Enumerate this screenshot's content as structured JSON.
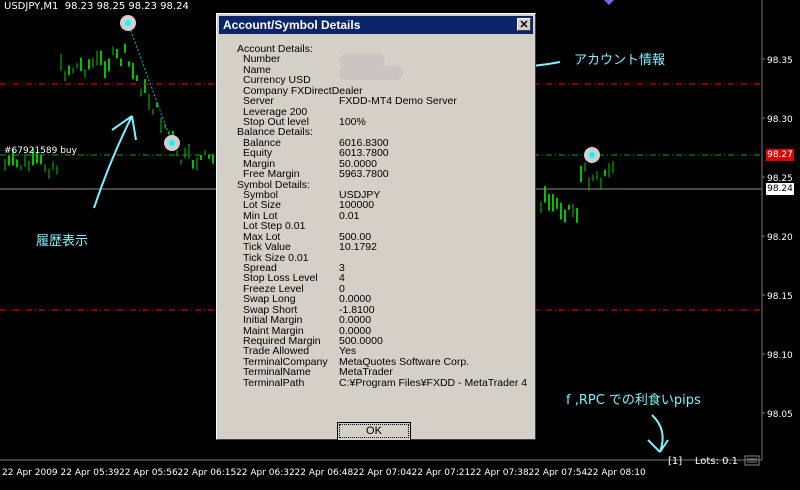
{
  "chart": {
    "symbol": "USDJPY,M1",
    "ohlc": "98.23 98.25 98.23 98.24",
    "ticket": "#67921589 buy",
    "prices": [
      "98.35",
      "98.30",
      "98.25",
      "98.20",
      "98.15",
      "98.10",
      "98.05"
    ],
    "price_red": "98.27",
    "price_white": "98.24",
    "times": [
      "22 Apr 2009",
      "22 Apr 05:39",
      "22 Apr 05:56",
      "22 Apr 06:15",
      "22 Apr 06:32",
      "22 Apr 06:48",
      "22 Apr 07:04",
      "22 Apr 07:21",
      "22 Apr 07:38",
      "22 Apr 07:54",
      "22 Apr 08:10"
    ],
    "status_index": "[1]",
    "lots": "Lots: 0.1",
    "colors": {
      "bull": "#00c000",
      "bear": "#006400",
      "redline": "#ff0000",
      "greenline": "#00aa00"
    }
  },
  "annotations": {
    "account": "アカウント情報",
    "history": "履歴表示",
    "pips": "f ,RPC での利食いpips"
  },
  "dialog": {
    "title": "Account/Symbol Details",
    "ok": "OK",
    "rows": [
      {
        "label": "Account Details:",
        "value": ""
      },
      {
        "label": "Number",
        "value": ""
      },
      {
        "label": "Name",
        "value": ""
      },
      {
        "label": "Currency USD",
        "value": ""
      },
      {
        "label": "Company FXDirectDealer",
        "value": ""
      },
      {
        "label": "Server",
        "value": "FXDD-MT4 Demo Server"
      },
      {
        "label": "Leverage 200",
        "value": ""
      },
      {
        "label": "Stop Out level",
        "value": "100%"
      },
      {
        "label": "Balance Details:",
        "value": ""
      },
      {
        "label": "Balance",
        "value": "6016.8300"
      },
      {
        "label": "Equity",
        "value": "6013.7800"
      },
      {
        "label": "Margin",
        "value": "50.0000"
      },
      {
        "label": "Free Margin",
        "value": "5963.7800"
      },
      {
        "label": "Symbol Details:",
        "value": ""
      },
      {
        "label": "Symbol",
        "value": "USDJPY"
      },
      {
        "label": "Lot Size",
        "value": "100000"
      },
      {
        "label": "Min Lot",
        "value": "0.01"
      },
      {
        "label": "Lot Step 0.01",
        "value": ""
      },
      {
        "label": "Max Lot",
        "value": "500.00"
      },
      {
        "label": "Tick Value",
        "value": "10.1792"
      },
      {
        "label": "Tick Size 0.01",
        "value": ""
      },
      {
        "label": "Spread",
        "value": "3"
      },
      {
        "label": "Stop Loss Level",
        "value": "4"
      },
      {
        "label": "Freeze Level",
        "value": "0"
      },
      {
        "label": "Swap Long",
        "value": "0.0000"
      },
      {
        "label": "Swap Short",
        "value": "-1.8100"
      },
      {
        "label": "Initial Margin",
        "value": "0.0000"
      },
      {
        "label": "Maint Margin",
        "value": "0.0000"
      },
      {
        "label": "Required Margin",
        "value": "500.0000"
      },
      {
        "label": "Trade Allowed",
        "value": "Yes"
      },
      {
        "label": "TerminalCompany",
        "value": "MetaQuotes Software Corp."
      },
      {
        "label": "TerminalName",
        "value": "MetaTrader"
      },
      {
        "label": "TerminalPath",
        "value": "C:¥Program Files¥FXDD - MetaTrader 4"
      }
    ]
  }
}
